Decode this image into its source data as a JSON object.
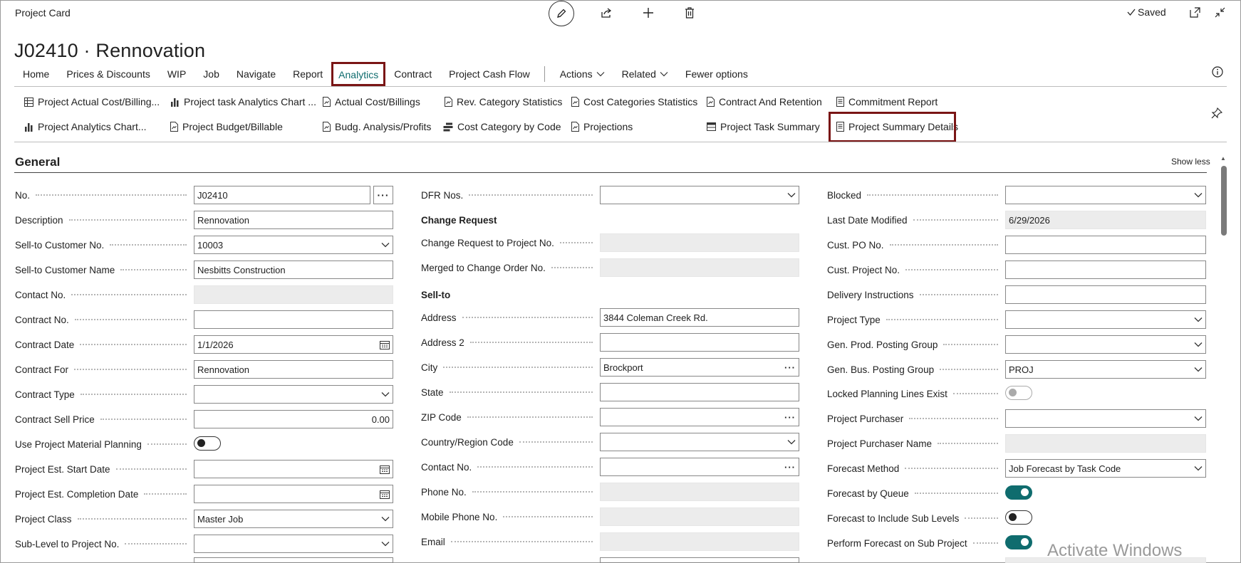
{
  "window": {
    "title": "Project Card",
    "saved_label": "Saved"
  },
  "page": {
    "title": "J02410 · Rennovation"
  },
  "tabs": [
    {
      "label": "Home"
    },
    {
      "label": "Prices & Discounts"
    },
    {
      "label": "WIP"
    },
    {
      "label": "Job"
    },
    {
      "label": "Navigate"
    },
    {
      "label": "Report"
    },
    {
      "label": "Analytics",
      "active": true
    },
    {
      "label": "Contract"
    },
    {
      "label": "Project Cash Flow"
    }
  ],
  "tabs_more": [
    {
      "label": "Actions"
    },
    {
      "label": "Related"
    },
    {
      "label": "Fewer options"
    }
  ],
  "ribbon": {
    "row1": [
      {
        "label": "Project Actual Cost/Billing...",
        "icon": "grid-icon"
      },
      {
        "label": "Project task Analytics Chart ...",
        "icon": "chart-icon"
      },
      {
        "label": "Actual Cost/Billings",
        "icon": "report-icon"
      },
      {
        "label": "Rev. Category Statistics",
        "icon": "report-icon"
      },
      {
        "label": "Cost Categories Statistics",
        "icon": "report-icon"
      },
      {
        "label": "Contract And Retention",
        "icon": "report-icon"
      },
      {
        "label": "Commitment Report",
        "icon": "document-icon"
      }
    ],
    "row2": [
      {
        "label": "Project Analytics Chart...",
        "icon": "chart-icon"
      },
      {
        "label": "Project Budget/Billable",
        "icon": "report-icon"
      },
      {
        "label": "Budg. Analysis/Profits",
        "icon": "report-icon"
      },
      {
        "label": "Cost Category by Code",
        "icon": "list-icon"
      },
      {
        "label": "Projections",
        "icon": "report-icon"
      },
      {
        "label": "Project Task Summary",
        "icon": "table-icon"
      },
      {
        "label": "Project Summary Details",
        "icon": "document-icon"
      }
    ]
  },
  "section": {
    "title": "General",
    "show_less": "Show less"
  },
  "col1": [
    {
      "label": "No.",
      "value": "J02410",
      "kind": "text-ellipsis"
    },
    {
      "label": "Description",
      "value": "Rennovation",
      "kind": "text"
    },
    {
      "label": "Sell-to Customer No.",
      "value": "10003",
      "kind": "dropdown"
    },
    {
      "label": "Sell-to Customer Name",
      "value": "Nesbitts Construction",
      "kind": "text"
    },
    {
      "label": "Contact No.",
      "value": "",
      "kind": "readonly"
    },
    {
      "label": "Contract No.",
      "value": "",
      "kind": "text"
    },
    {
      "label": "Contract Date",
      "value": "1/1/2026",
      "kind": "date"
    },
    {
      "label": "Contract For",
      "value": "Rennovation",
      "kind": "text"
    },
    {
      "label": "Contract Type",
      "value": "",
      "kind": "dropdown"
    },
    {
      "label": "Contract Sell Price",
      "value": "0.00",
      "kind": "number"
    },
    {
      "label": "Use Project Material Planning",
      "value": "off",
      "kind": "toggle"
    },
    {
      "label": "Project Est. Start Date",
      "value": "",
      "kind": "date"
    },
    {
      "label": "Project Est. Completion Date",
      "value": "",
      "kind": "date"
    },
    {
      "label": "Project Class",
      "value": "Master Job",
      "kind": "dropdown"
    },
    {
      "label": "Sub-Level to Project No.",
      "value": "",
      "kind": "dropdown"
    }
  ],
  "col2": {
    "dfr": {
      "label": "DFR Nos.",
      "value": ""
    },
    "change_request_heading": "Change Request",
    "change_request": [
      {
        "label": "Change Request to Project No.",
        "value": ""
      },
      {
        "label": "Merged to Change Order No.",
        "value": ""
      }
    ],
    "sell_to_heading": "Sell-to",
    "sell_to": [
      {
        "label": "Address",
        "value": "3844 Coleman Creek Rd.",
        "kind": "text"
      },
      {
        "label": "Address 2",
        "value": "",
        "kind": "text"
      },
      {
        "label": "City",
        "value": "Brockport",
        "kind": "lookup"
      },
      {
        "label": "State",
        "value": "",
        "kind": "text"
      },
      {
        "label": "ZIP Code",
        "value": "",
        "kind": "lookup"
      },
      {
        "label": "Country/Region Code",
        "value": "",
        "kind": "dropdown"
      },
      {
        "label": "Contact No.",
        "value": "",
        "kind": "lookup"
      },
      {
        "label": "Phone No.",
        "value": "",
        "kind": "readonly"
      },
      {
        "label": "Mobile Phone No.",
        "value": "",
        "kind": "readonly"
      },
      {
        "label": "Email",
        "value": "",
        "kind": "readonly"
      }
    ]
  },
  "col3": [
    {
      "label": "Blocked",
      "value": "",
      "kind": "dropdown"
    },
    {
      "label": "Last Date Modified",
      "value": "6/29/2026",
      "kind": "readonly"
    },
    {
      "label": "Cust. PO No.",
      "value": "",
      "kind": "text"
    },
    {
      "label": "Cust. Project No.",
      "value": "",
      "kind": "text"
    },
    {
      "label": "Delivery Instructions",
      "value": "",
      "kind": "text"
    },
    {
      "label": "Project Type",
      "value": "",
      "kind": "dropdown"
    },
    {
      "label": "Gen. Prod. Posting Group",
      "value": "",
      "kind": "dropdown"
    },
    {
      "label": "Gen. Bus. Posting Group",
      "value": "PROJ",
      "kind": "dropdown"
    },
    {
      "label": "Locked Planning Lines Exist",
      "value": "off",
      "kind": "toggle-disabled"
    },
    {
      "label": "Project Purchaser",
      "value": "",
      "kind": "dropdown"
    },
    {
      "label": "Project Purchaser Name",
      "value": "",
      "kind": "readonly"
    },
    {
      "label": "Forecast Method",
      "value": "Job Forecast by Task Code",
      "kind": "dropdown"
    },
    {
      "label": "Forecast by Queue",
      "value": "on",
      "kind": "toggle"
    },
    {
      "label": "Forecast to Include Sub Levels",
      "value": "off",
      "kind": "toggle"
    },
    {
      "label": "Perform Forecast on Sub Project",
      "value": "on",
      "kind": "toggle"
    }
  ],
  "watermark": "Activate Windows",
  "colors": {
    "accent": "#0f6c6e",
    "highlight_border": "#7a1515"
  }
}
